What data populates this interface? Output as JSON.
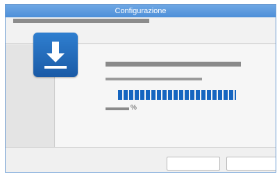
{
  "window": {
    "title": "Configurazione"
  },
  "progress": {
    "value": 1.0,
    "unit": "%"
  },
  "icons": {
    "install": "download-install-icon"
  },
  "colors": {
    "titlebar": "#5b9ae0",
    "icon": "#1f66b5",
    "progress": "#1565c0"
  }
}
